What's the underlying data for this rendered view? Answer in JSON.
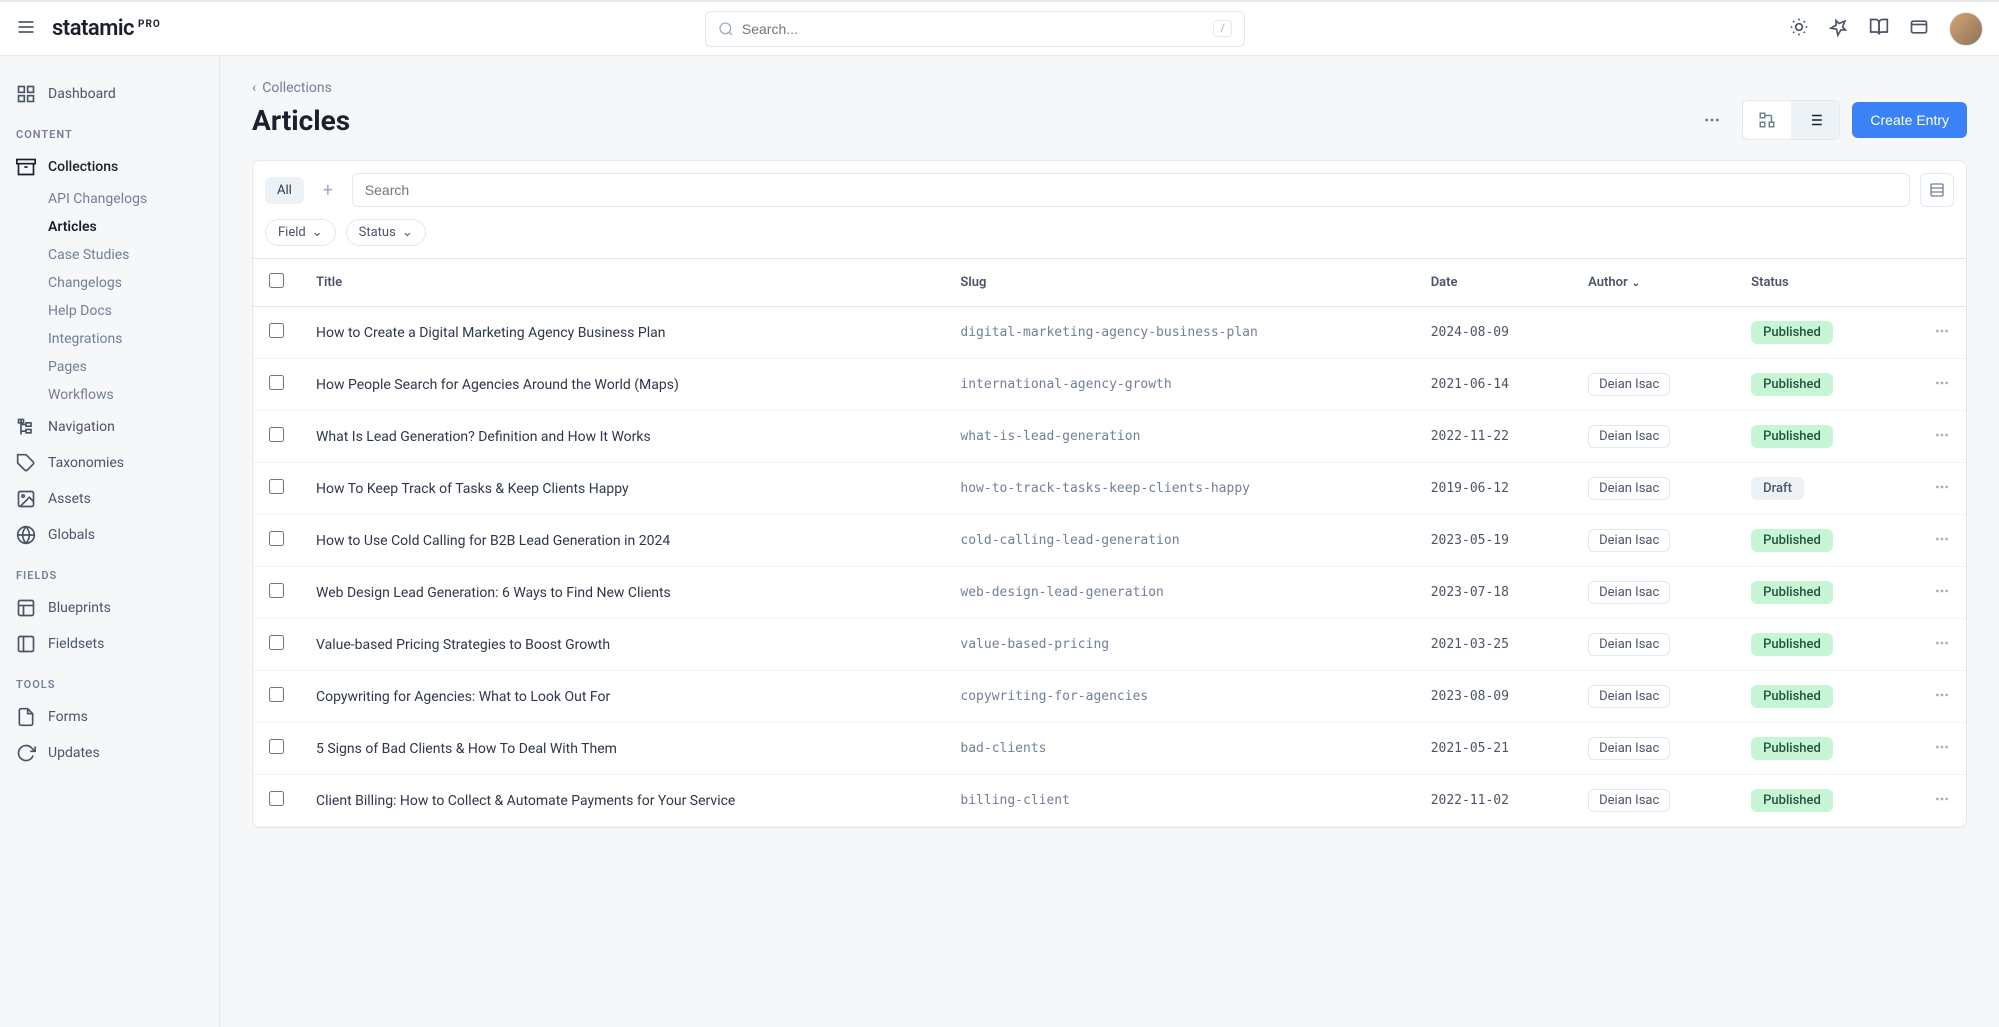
{
  "topbar": {
    "logo": "statamic",
    "logo_badge": "PRO",
    "search_placeholder": "Search...",
    "search_kbd": "/"
  },
  "sidebar": {
    "dashboard": "Dashboard",
    "sections": {
      "content": "CONTENT",
      "fields": "FIELDS",
      "tools": "TOOLS"
    },
    "content_items": {
      "collections": "Collections",
      "navigation": "Navigation",
      "taxonomies": "Taxonomies",
      "assets": "Assets",
      "globals": "Globals"
    },
    "collections_sub": [
      "API Changelogs",
      "Articles",
      "Case Studies",
      "Changelogs",
      "Help Docs",
      "Integrations",
      "Pages",
      "Workflows"
    ],
    "fields_items": {
      "blueprints": "Blueprints",
      "fieldsets": "Fieldsets"
    },
    "tools_items": {
      "forms": "Forms",
      "updates": "Updates"
    }
  },
  "breadcrumb": "Collections",
  "page_title": "Articles",
  "create_button": "Create Entry",
  "filters": {
    "tab_all": "All",
    "search_placeholder": "Search",
    "field": "Field",
    "status": "Status"
  },
  "columns": {
    "title": "Title",
    "slug": "Slug",
    "date": "Date",
    "author": "Author",
    "status": "Status"
  },
  "rows": [
    {
      "title": "How to Create a Digital Marketing Agency Business Plan",
      "slug": "digital-marketing-agency-business-plan",
      "date": "2024-08-09",
      "author": "",
      "status": "Published"
    },
    {
      "title": "How People Search for Agencies Around the World (Maps)",
      "slug": "international-agency-growth",
      "date": "2021-06-14",
      "author": "Deian Isac",
      "status": "Published"
    },
    {
      "title": "What Is Lead Generation? Definition and How It Works",
      "slug": "what-is-lead-generation",
      "date": "2022-11-22",
      "author": "Deian Isac",
      "status": "Published"
    },
    {
      "title": "How To Keep Track of Tasks & Keep Clients Happy",
      "slug": "how-to-track-tasks-keep-clients-happy",
      "date": "2019-06-12",
      "author": "Deian Isac",
      "status": "Draft"
    },
    {
      "title": "How to Use Cold Calling for B2B Lead Generation in 2024",
      "slug": "cold-calling-lead-generation",
      "date": "2023-05-19",
      "author": "Deian Isac",
      "status": "Published"
    },
    {
      "title": "Web Design Lead Generation: 6 Ways to Find New Clients",
      "slug": "web-design-lead-generation",
      "date": "2023-07-18",
      "author": "Deian Isac",
      "status": "Published"
    },
    {
      "title": "Value-based Pricing Strategies to Boost Growth",
      "slug": "value-based-pricing",
      "date": "2021-03-25",
      "author": "Deian Isac",
      "status": "Published"
    },
    {
      "title": "Copywriting for Agencies: What to Look Out For",
      "slug": "copywriting-for-agencies",
      "date": "2023-08-09",
      "author": "Deian Isac",
      "status": "Published"
    },
    {
      "title": "5 Signs of Bad Clients & How To Deal With Them",
      "slug": "bad-clients",
      "date": "2021-05-21",
      "author": "Deian Isac",
      "status": "Published"
    },
    {
      "title": "Client Billing: How to Collect & Automate Payments for Your Service",
      "slug": "billing-client",
      "date": "2022-11-02",
      "author": "Deian Isac",
      "status": "Published"
    }
  ]
}
